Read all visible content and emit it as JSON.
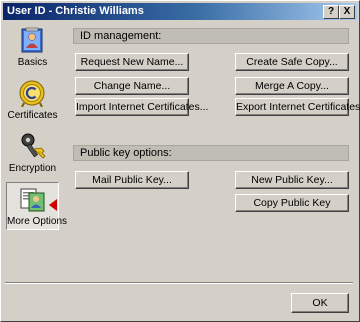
{
  "window": {
    "title": "User ID - Christie Williams",
    "help_glyph": "?",
    "close_glyph": "X"
  },
  "sidebar": {
    "items": [
      {
        "label": "Basics",
        "icon": "basics-icon",
        "selected": false
      },
      {
        "label": "Certificates",
        "icon": "certificate-icon",
        "selected": false
      },
      {
        "label": "Encryption",
        "icon": "key-icon",
        "selected": false
      },
      {
        "label": "More Options",
        "icon": "more-options-icon",
        "selected": true
      }
    ]
  },
  "id_management": {
    "header": "ID management:",
    "buttons": {
      "request_new_name": "Request New Name...",
      "create_safe_copy": "Create Safe Copy...",
      "change_name": "Change Name...",
      "merge_copy": "Merge A Copy...",
      "import_certs": "Import Internet Certificates...",
      "export_certs": "Export Internet Certificates..."
    }
  },
  "public_key": {
    "header": "Public key options:",
    "buttons": {
      "mail_public_key": "Mail Public Key...",
      "new_public_key": "New Public Key...",
      "copy_public_key": "Copy Public Key"
    }
  },
  "footer": {
    "ok_label": "OK"
  }
}
